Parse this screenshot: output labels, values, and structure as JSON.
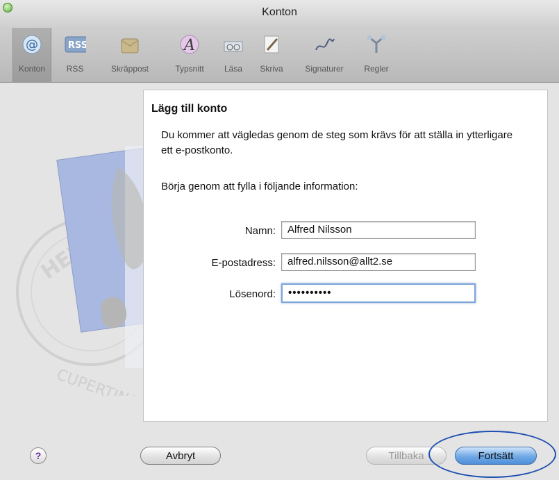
{
  "window": {
    "title": "Konton"
  },
  "toolbar": {
    "items": [
      {
        "label": "Konton",
        "icon": "at-icon",
        "selected": true
      },
      {
        "label": "RSS",
        "icon": "rss-icon"
      },
      {
        "label": "Skräppost",
        "icon": "junk-mail-icon"
      },
      {
        "label": "Typsnitt",
        "icon": "font-icon"
      },
      {
        "label": "Läsa",
        "icon": "glasses-icon"
      },
      {
        "label": "Skriva",
        "icon": "pencil-icon"
      },
      {
        "label": "Signaturer",
        "icon": "signature-icon"
      },
      {
        "label": "Regler",
        "icon": "rules-icon"
      }
    ]
  },
  "dialog": {
    "heading": "Lägg till konto",
    "intro": "Du kommer att vägledas genom de steg som krävs för att ställa in ytterligare ett e-postkonto.",
    "instruction": "Börja genom att fylla i följande information:",
    "form": {
      "name_label": "Namn:",
      "name_value": "Alfred Nilsson",
      "email_label": "E-postadress:",
      "email_value": "alfred.nilsson@allt2.se",
      "password_label": "Lösenord:",
      "password_value": "••••••••••"
    },
    "stamp": {
      "text_top": "HELLO FR",
      "text_bottom": "CUPERTINO CA"
    }
  },
  "buttons": {
    "help": "?",
    "cancel": "Avbryt",
    "back": "Tillbaka",
    "continue": "Fortsätt"
  },
  "colors": {
    "accent": "#4f8fd9",
    "annotation": "#1c4fb0"
  }
}
